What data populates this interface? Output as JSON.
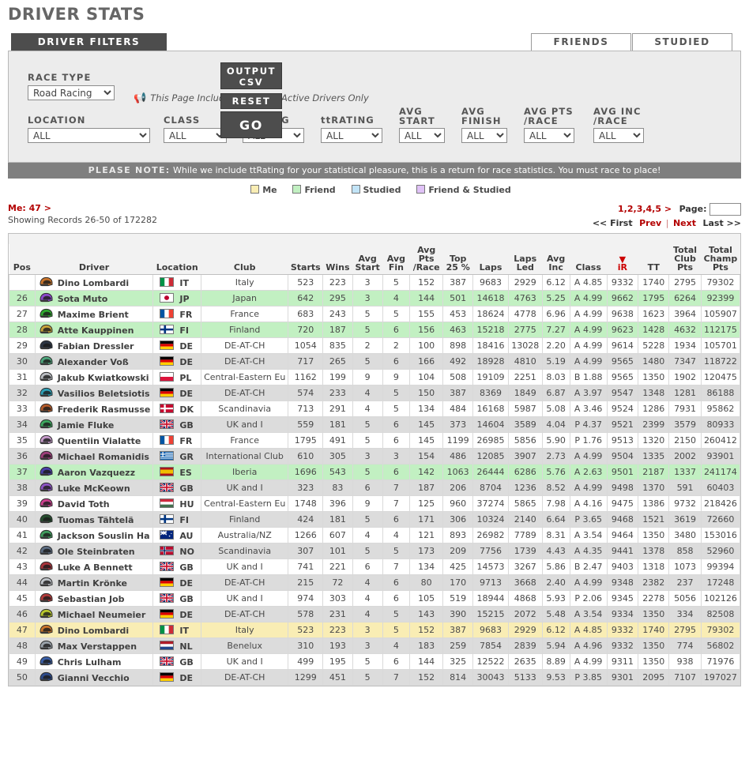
{
  "page_title": "DRIVER STATS",
  "tabs": [
    {
      "id": "driver-filters",
      "label": "DRIVER FILTERS",
      "active": true
    },
    {
      "id": "friends",
      "label": "FRIENDS",
      "active": false
    },
    {
      "id": "studied",
      "label": "STUDIED",
      "active": false
    }
  ],
  "filters": {
    "race_type": {
      "label": "RACE TYPE",
      "value": "Road Racing"
    },
    "notice": "This Page Includes Stats For Active Drivers Only",
    "fields": [
      {
        "id": "location",
        "label": "LOCATION",
        "value": "ALL"
      },
      {
        "id": "class",
        "label": "CLASS",
        "value": "ALL"
      },
      {
        "id": "irating",
        "label": "iRATING",
        "value": "ALL"
      },
      {
        "id": "ttrating",
        "label": "ttRATING",
        "value": "ALL"
      },
      {
        "id": "avg-start",
        "label": "AVG\nSTART",
        "label1": "AVG",
        "label2": "START",
        "value": "ALL"
      },
      {
        "id": "avg-finish",
        "label1": "AVG",
        "label2": "FINISH",
        "value": "ALL"
      },
      {
        "id": "avg-pts-race",
        "label1": "AVG PTS",
        "label2": "/RACE",
        "value": "ALL"
      },
      {
        "id": "avg-inc-race",
        "label1": "AVG INC",
        "label2": "/RACE",
        "value": "ALL"
      }
    ],
    "buttons": {
      "output_csv_line1": "OUTPUT",
      "output_csv_line2": "CSV",
      "reset": "RESET",
      "go": "GO"
    }
  },
  "please_note": {
    "prefix": "PLEASE NOTE:",
    "text": "While we include ttRating for your statistical pleasure, this is a return for race statistics. You must race to place!"
  },
  "legend": [
    {
      "label": "Me",
      "color": "#f9edb4"
    },
    {
      "label": "Friend",
      "color": "#c2f0c2"
    },
    {
      "label": "Studied",
      "color": "#c2e4f7"
    },
    {
      "label": "Friend & Studied",
      "color": "#e0c2f7"
    }
  ],
  "info": {
    "me_line": "Me: 47 >",
    "records": "Showing Records 26-50 of 172282"
  },
  "pager": {
    "pages": "1,2,3,4,5 >",
    "page_label": "Page:",
    "page_value": "",
    "first": "<< First",
    "prev": "Prev",
    "sep": "|",
    "next": "Next",
    "last": "Last >>"
  },
  "table": {
    "columns": [
      {
        "id": "pos",
        "l1": "",
        "l2": "Pos"
      },
      {
        "id": "driver",
        "l1": "",
        "l2": "Driver"
      },
      {
        "id": "location",
        "l1": "",
        "l2": "Location"
      },
      {
        "id": "club",
        "l1": "",
        "l2": "Club"
      },
      {
        "id": "starts",
        "l1": "",
        "l2": "Starts"
      },
      {
        "id": "wins",
        "l1": "",
        "l2": "Wins"
      },
      {
        "id": "avg_start",
        "l1": "Avg",
        "l2": "Start"
      },
      {
        "id": "avg_fin",
        "l1": "Avg",
        "l2": "Fin"
      },
      {
        "id": "avg_pts_race",
        "l1": "Avg",
        "l15": "Pts",
        "l2": "/Race"
      },
      {
        "id": "top25",
        "l1": "Top",
        "l2": "25 %"
      },
      {
        "id": "laps",
        "l1": "",
        "l2": "Laps"
      },
      {
        "id": "laps_led",
        "l1": "Laps",
        "l2": "Led"
      },
      {
        "id": "avg_inc",
        "l1": "Avg",
        "l2": "Inc"
      },
      {
        "id": "class",
        "l1": "",
        "l2": "Class"
      },
      {
        "id": "ir",
        "l1": "▼",
        "l2": "iR",
        "sorted": true
      },
      {
        "id": "tt",
        "l1": "",
        "l2": "TT"
      },
      {
        "id": "total_club_pts",
        "l1": "Total",
        "l15": "Club",
        "l2": "Pts"
      },
      {
        "id": "total_champ_pts",
        "l1": "Total",
        "l15": "Champ",
        "l2": "Pts"
      }
    ],
    "rows": [
      {
        "pos": "",
        "driver": "Dino Lombardi",
        "cc": "IT",
        "flag": "it",
        "club": "Italy",
        "starts": "523",
        "wins": "223",
        "avg_start": "3",
        "avg_fin": "5",
        "avg_pts_race": "152",
        "top25": "387",
        "laps": "9683",
        "laps_led": "2929",
        "avg_inc": "6.12",
        "class": "A 4.85",
        "ir": "9332",
        "tt": "1740",
        "club_pts": "2795",
        "champ_pts": "79302",
        "hl": "",
        "helmet": "#c9742a"
      },
      {
        "pos": "26",
        "driver": "Sota Muto",
        "cc": "JP",
        "flag": "jp",
        "club": "Japan",
        "starts": "642",
        "wins": "295",
        "avg_start": "3",
        "avg_fin": "4",
        "avg_pts_race": "144",
        "top25": "501",
        "laps": "14618",
        "laps_led": "4763",
        "avg_inc": "5.25",
        "class": "A 4.99",
        "ir": "9662",
        "tt": "1795",
        "club_pts": "6264",
        "champ_pts": "92399",
        "hl": "friend",
        "helmet": "#8b49c9"
      },
      {
        "pos": "27",
        "driver": "Maxime Brient",
        "cc": "FR",
        "flag": "fr",
        "club": "France",
        "starts": "683",
        "wins": "243",
        "avg_start": "5",
        "avg_fin": "5",
        "avg_pts_race": "155",
        "top25": "453",
        "laps": "18624",
        "laps_led": "4778",
        "avg_inc": "6.96",
        "class": "A 4.99",
        "ir": "9638",
        "tt": "1623",
        "club_pts": "3964",
        "champ_pts": "105907",
        "hl": "",
        "helmet": "#2fa82f"
      },
      {
        "pos": "28",
        "driver": "Atte Kauppinen",
        "cc": "FI",
        "flag": "fi",
        "club": "Finland",
        "starts": "720",
        "wins": "187",
        "avg_start": "5",
        "avg_fin": "6",
        "avg_pts_race": "156",
        "top25": "463",
        "laps": "15218",
        "laps_led": "2775",
        "avg_inc": "7.27",
        "class": "A 4.99",
        "ir": "9623",
        "tt": "1428",
        "club_pts": "4632",
        "champ_pts": "112175",
        "hl": "friend",
        "helmet": "#c7a33a"
      },
      {
        "pos": "29",
        "driver": "Fabian Dressler",
        "cc": "DE",
        "flag": "de",
        "club": "DE-AT-CH",
        "starts": "1054",
        "wins": "835",
        "avg_start": "2",
        "avg_fin": "2",
        "avg_pts_race": "100",
        "top25": "898",
        "laps": "18416",
        "laps_led": "13028",
        "avg_inc": "2.20",
        "class": "A 4.99",
        "ir": "9614",
        "tt": "5228",
        "club_pts": "1934",
        "champ_pts": "105701",
        "hl": "",
        "helmet": "#2b3442"
      },
      {
        "pos": "30",
        "driver": "Alexander Voß",
        "cc": "DE",
        "flag": "de",
        "club": "DE-AT-CH",
        "starts": "717",
        "wins": "265",
        "avg_start": "5",
        "avg_fin": "6",
        "avg_pts_race": "166",
        "top25": "492",
        "laps": "18928",
        "laps_led": "4810",
        "avg_inc": "5.19",
        "class": "A 4.99",
        "ir": "9565",
        "tt": "1480",
        "club_pts": "7347",
        "champ_pts": "118722",
        "hl": "alt",
        "helmet": "#4ea57c"
      },
      {
        "pos": "31",
        "driver": "Jakub Kwiatkowski",
        "cc": "PL",
        "flag": "pl",
        "club": "Central-Eastern Eu",
        "starts": "1162",
        "wins": "199",
        "avg_start": "9",
        "avg_fin": "9",
        "avg_pts_race": "104",
        "top25": "508",
        "laps": "19109",
        "laps_led": "2251",
        "avg_inc": "8.03",
        "class": "B 1.88",
        "ir": "9565",
        "tt": "1350",
        "club_pts": "1902",
        "champ_pts": "120475",
        "hl": "",
        "helmet": "#b9bcc1"
      },
      {
        "pos": "32",
        "driver": "Vasilios Beletsiotis",
        "cc": "DE",
        "flag": "de",
        "club": "DE-AT-CH",
        "starts": "574",
        "wins": "233",
        "avg_start": "4",
        "avg_fin": "5",
        "avg_pts_race": "150",
        "top25": "387",
        "laps": "8369",
        "laps_led": "1849",
        "avg_inc": "6.87",
        "class": "A 3.97",
        "ir": "9547",
        "tt": "1348",
        "club_pts": "1281",
        "champ_pts": "86188",
        "hl": "alt",
        "helmet": "#2e9fb5"
      },
      {
        "pos": "33",
        "driver": "Frederik Rasmusse",
        "cc": "DK",
        "flag": "dk",
        "club": "Scandinavia",
        "starts": "713",
        "wins": "291",
        "avg_start": "4",
        "avg_fin": "5",
        "avg_pts_race": "134",
        "top25": "484",
        "laps": "16168",
        "laps_led": "5987",
        "avg_inc": "5.08",
        "class": "A 3.46",
        "ir": "9524",
        "tt": "1286",
        "club_pts": "7931",
        "champ_pts": "95862",
        "hl": "",
        "helmet": "#b35a2a"
      },
      {
        "pos": "34",
        "driver": "Jamie Fluke",
        "cc": "GB",
        "flag": "gb",
        "club": "UK and I",
        "starts": "559",
        "wins": "181",
        "avg_start": "5",
        "avg_fin": "6",
        "avg_pts_race": "145",
        "top25": "373",
        "laps": "14604",
        "laps_led": "3589",
        "avg_inc": "4.04",
        "class": "P 4.37",
        "ir": "9521",
        "tt": "2399",
        "club_pts": "3579",
        "champ_pts": "80933",
        "hl": "alt",
        "helmet": "#3da85e"
      },
      {
        "pos": "35",
        "driver": "Quentiin Vialatte",
        "cc": "FR",
        "flag": "fr",
        "club": "France",
        "starts": "1795",
        "wins": "491",
        "avg_start": "5",
        "avg_fin": "6",
        "avg_pts_race": "145",
        "top25": "1199",
        "laps": "26985",
        "laps_led": "5856",
        "avg_inc": "5.90",
        "class": "P 1.76",
        "ir": "9513",
        "tt": "1320",
        "club_pts": "2150",
        "champ_pts": "260412",
        "hl": "",
        "helmet": "#c79ccc"
      },
      {
        "pos": "36",
        "driver": "Michael Romanidis",
        "cc": "GR",
        "flag": "gr",
        "club": "International Club",
        "starts": "610",
        "wins": "305",
        "avg_start": "3",
        "avg_fin": "3",
        "avg_pts_race": "154",
        "top25": "486",
        "laps": "12085",
        "laps_led": "3907",
        "avg_inc": "2.73",
        "class": "A 4.99",
        "ir": "9504",
        "tt": "1335",
        "club_pts": "2002",
        "champ_pts": "93901",
        "hl": "alt",
        "helmet": "#9d3f7a"
      },
      {
        "pos": "37",
        "driver": "Aaron Vazquezz",
        "cc": "ES",
        "flag": "es",
        "club": "Iberia",
        "starts": "1696",
        "wins": "543",
        "avg_start": "5",
        "avg_fin": "6",
        "avg_pts_race": "142",
        "top25": "1063",
        "laps": "26444",
        "laps_led": "6286",
        "avg_inc": "5.76",
        "class": "A 2.63",
        "ir": "9501",
        "tt": "2187",
        "club_pts": "1337",
        "champ_pts": "241174",
        "hl": "friend",
        "helmet": "#4a3fa8"
      },
      {
        "pos": "38",
        "driver": "Luke McKeown",
        "cc": "GB",
        "flag": "gb",
        "club": "UK and I",
        "starts": "323",
        "wins": "83",
        "avg_start": "6",
        "avg_fin": "7",
        "avg_pts_race": "187",
        "top25": "206",
        "laps": "8704",
        "laps_led": "1236",
        "avg_inc": "8.52",
        "class": "A 4.99",
        "ir": "9498",
        "tt": "1370",
        "club_pts": "591",
        "champ_pts": "60403",
        "hl": "alt",
        "helmet": "#8e54c4"
      },
      {
        "pos": "39",
        "driver": "David Toth",
        "cc": "HU",
        "flag": "hu",
        "club": "Central-Eastern Eu",
        "starts": "1748",
        "wins": "396",
        "avg_start": "9",
        "avg_fin": "7",
        "avg_pts_race": "125",
        "top25": "960",
        "laps": "37274",
        "laps_led": "5865",
        "avg_inc": "7.98",
        "class": "A 4.16",
        "ir": "9475",
        "tt": "1386",
        "club_pts": "9732",
        "champ_pts": "218426",
        "hl": "",
        "helmet": "#cc3f8f"
      },
      {
        "pos": "40",
        "driver": "Tuomas Tähtelä",
        "cc": "FI",
        "flag": "fi",
        "club": "Finland",
        "starts": "424",
        "wins": "181",
        "avg_start": "5",
        "avg_fin": "6",
        "avg_pts_race": "171",
        "top25": "306",
        "laps": "10324",
        "laps_led": "2140",
        "avg_inc": "6.64",
        "class": "P 3.65",
        "ir": "9468",
        "tt": "1521",
        "club_pts": "3619",
        "champ_pts": "72660",
        "hl": "alt",
        "helmet": "#254d2e"
      },
      {
        "pos": "41",
        "driver": "Jackson Souslin Ha",
        "cc": "AU",
        "flag": "au",
        "club": "Australia/NZ",
        "starts": "1266",
        "wins": "607",
        "avg_start": "4",
        "avg_fin": "4",
        "avg_pts_race": "121",
        "top25": "893",
        "laps": "26982",
        "laps_led": "7789",
        "avg_inc": "8.31",
        "class": "A 3.54",
        "ir": "9464",
        "tt": "1350",
        "club_pts": "3480",
        "champ_pts": "153016",
        "hl": "",
        "helmet": "#3f9b5c"
      },
      {
        "pos": "42",
        "driver": "Ole Steinbraten",
        "cc": "NO",
        "flag": "no",
        "club": "Scandinavia",
        "starts": "307",
        "wins": "101",
        "avg_start": "5",
        "avg_fin": "5",
        "avg_pts_race": "173",
        "top25": "209",
        "laps": "7756",
        "laps_led": "1739",
        "avg_inc": "4.43",
        "class": "A 4.35",
        "ir": "9441",
        "tt": "1378",
        "club_pts": "858",
        "champ_pts": "52960",
        "hl": "alt",
        "helmet": "#5b6b80"
      },
      {
        "pos": "43",
        "driver": "Luke A Bennett",
        "cc": "GB",
        "flag": "gb",
        "club": "UK and I",
        "starts": "741",
        "wins": "221",
        "avg_start": "6",
        "avg_fin": "7",
        "avg_pts_race": "134",
        "top25": "425",
        "laps": "14573",
        "laps_led": "3267",
        "avg_inc": "5.86",
        "class": "B 2.47",
        "ir": "9403",
        "tt": "1318",
        "club_pts": "1073",
        "champ_pts": "99394",
        "hl": "",
        "helmet": "#a8343c"
      },
      {
        "pos": "44",
        "driver": "Martin Krönke",
        "cc": "DE",
        "flag": "de",
        "club": "DE-AT-CH",
        "starts": "215",
        "wins": "72",
        "avg_start": "4",
        "avg_fin": "6",
        "avg_pts_race": "80",
        "top25": "170",
        "laps": "9713",
        "laps_led": "3668",
        "avg_inc": "2.40",
        "class": "A 4.99",
        "ir": "9348",
        "tt": "2382",
        "club_pts": "237",
        "champ_pts": "17248",
        "hl": "alt",
        "helmet": "#c0c4c9"
      },
      {
        "pos": "45",
        "driver": "Sebastian Job",
        "cc": "GB",
        "flag": "gb",
        "club": "UK and I",
        "starts": "974",
        "wins": "303",
        "avg_start": "4",
        "avg_fin": "6",
        "avg_pts_race": "105",
        "top25": "519",
        "laps": "18944",
        "laps_led": "4868",
        "avg_inc": "5.93",
        "class": "P 2.06",
        "ir": "9345",
        "tt": "2278",
        "club_pts": "5056",
        "champ_pts": "102126",
        "hl": "",
        "helmet": "#b03a3a"
      },
      {
        "pos": "46",
        "driver": "Michael Neumeier",
        "cc": "DE",
        "flag": "de",
        "club": "DE-AT-CH",
        "starts": "578",
        "wins": "231",
        "avg_start": "4",
        "avg_fin": "5",
        "avg_pts_race": "143",
        "top25": "390",
        "laps": "15215",
        "laps_led": "2072",
        "avg_inc": "5.48",
        "class": "A 3.54",
        "ir": "9334",
        "tt": "1350",
        "club_pts": "334",
        "champ_pts": "82508",
        "hl": "alt",
        "helmet": "#b8c72e"
      },
      {
        "pos": "47",
        "driver": "Dino Lombardi",
        "cc": "IT",
        "flag": "it",
        "club": "Italy",
        "starts": "523",
        "wins": "223",
        "avg_start": "3",
        "avg_fin": "5",
        "avg_pts_race": "152",
        "top25": "387",
        "laps": "9683",
        "laps_led": "2929",
        "avg_inc": "6.12",
        "class": "A 4.85",
        "ir": "9332",
        "tt": "1740",
        "club_pts": "2795",
        "champ_pts": "79302",
        "hl": "me",
        "helmet": "#c9742a"
      },
      {
        "pos": "48",
        "driver": "Max Verstappen",
        "cc": "NL",
        "flag": "nl",
        "club": "Benelux",
        "starts": "310",
        "wins": "193",
        "avg_start": "3",
        "avg_fin": "4",
        "avg_pts_race": "183",
        "top25": "259",
        "laps": "7854",
        "laps_led": "2839",
        "avg_inc": "5.94",
        "class": "A 4.96",
        "ir": "9332",
        "tt": "1350",
        "club_pts": "774",
        "champ_pts": "56802",
        "hl": "alt",
        "helmet": "#9aa2aa"
      },
      {
        "pos": "49",
        "driver": "Chris Lulham",
        "cc": "GB",
        "flag": "gb",
        "club": "UK and I",
        "starts": "499",
        "wins": "195",
        "avg_start": "5",
        "avg_fin": "6",
        "avg_pts_race": "144",
        "top25": "325",
        "laps": "12522",
        "laps_led": "2635",
        "avg_inc": "8.89",
        "class": "A 4.99",
        "ir": "9311",
        "tt": "1350",
        "club_pts": "938",
        "champ_pts": "71976",
        "hl": "",
        "helmet": "#3a5fa8"
      },
      {
        "pos": "50",
        "driver": "Gianni Vecchio",
        "cc": "DE",
        "flag": "de",
        "club": "DE-AT-CH",
        "starts": "1299",
        "wins": "451",
        "avg_start": "5",
        "avg_fin": "7",
        "avg_pts_race": "152",
        "top25": "814",
        "laps": "30043",
        "laps_led": "5133",
        "avg_inc": "9.53",
        "class": "P 3.85",
        "ir": "9301",
        "tt": "2095",
        "club_pts": "7107",
        "champ_pts": "197027",
        "hl": "alt",
        "helmet": "#2c4a8a"
      }
    ]
  }
}
